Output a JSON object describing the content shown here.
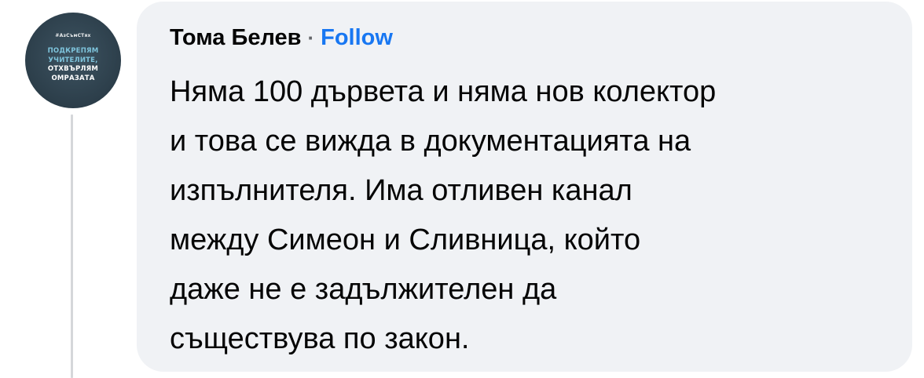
{
  "avatar": {
    "hashtag": "#АзСъмСТях",
    "lines": [
      "ПОДКРЕПЯМ",
      "УЧИТЕЛИТЕ,",
      "ОТХВЪРЛЯМ",
      "ОМРАЗАТА"
    ]
  },
  "comment": {
    "author": "Тома Белев",
    "separator": "·",
    "follow_label": "Follow",
    "text_lines": [
      "Няма 100 дървета и няма нов колектор",
      "и това се вижда в документацията на",
      "изпълнителя. Има отливен канал",
      "между Симеон и Сливница, който",
      "даже не е задължителен да",
      "съществува по закон."
    ]
  },
  "colors": {
    "bubble_background": "#f0f2f5",
    "follow_link": "#1877f2",
    "text": "#050505",
    "avatar_background": "#2c3e4a",
    "avatar_accent": "#7ec4dc",
    "thread_line": "#d5d7da"
  }
}
